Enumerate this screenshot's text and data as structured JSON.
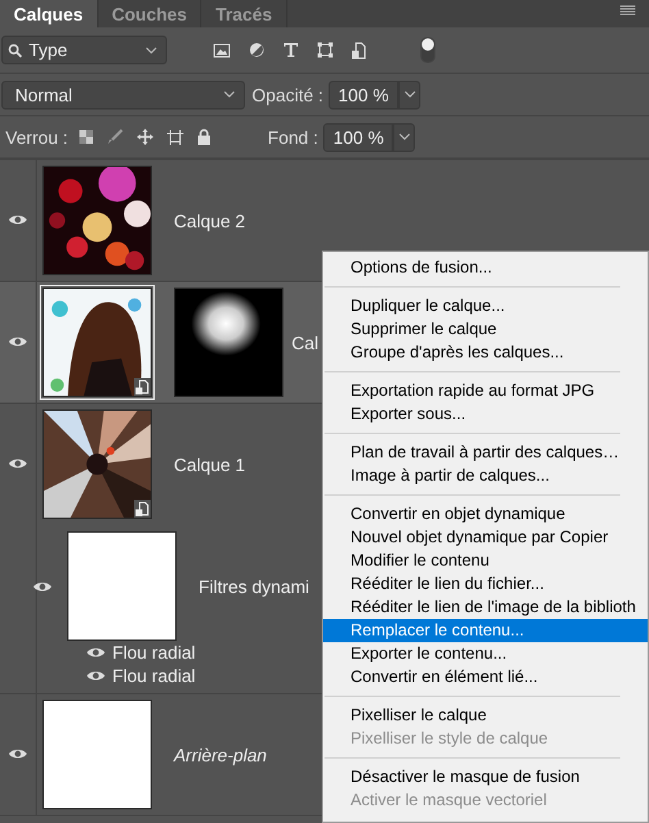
{
  "panel": {
    "tabs": [
      {
        "label": "Calques",
        "selected": true
      },
      {
        "label": "Couches",
        "selected": false
      },
      {
        "label": "Tracés",
        "selected": false
      }
    ],
    "filter": {
      "value": "Type"
    },
    "filter_switch": {
      "on": true
    },
    "blend_mode": {
      "value": "Normal"
    },
    "opacity": {
      "label": "Opacité :",
      "value": "100 %"
    },
    "lock": {
      "label": "Verrou :"
    },
    "fill": {
      "label": "Fond :",
      "value": "100 %"
    }
  },
  "layers": [
    {
      "name": "Calque 2",
      "visible": true,
      "selected": false,
      "kind": "picture",
      "smart_object": false,
      "mask": false
    },
    {
      "name": "Cal",
      "visible": true,
      "selected": true,
      "kind": "picture",
      "smart_object": true,
      "mask": true
    },
    {
      "name": "Calque 1",
      "visible": true,
      "selected": false,
      "kind": "picture",
      "smart_object": true,
      "mask": false,
      "smart_filters": {
        "label": "Filtres dynami",
        "visible": true,
        "items": [
          {
            "name": "Flou radial",
            "visible": true
          },
          {
            "name": "Flou radial",
            "visible": true
          }
        ]
      }
    },
    {
      "name": "Arrière-plan",
      "visible": true,
      "selected": false,
      "kind": "background",
      "smart_object": false,
      "mask": false
    }
  ],
  "context_menu": {
    "groups": [
      [
        {
          "label": "Options de fusion...",
          "selected": false,
          "disabled": false
        }
      ],
      [
        {
          "label": "Dupliquer le calque...",
          "selected": false,
          "disabled": false
        },
        {
          "label": "Supprimer le calque",
          "selected": false,
          "disabled": false
        },
        {
          "label": "Groupe d'après les calques...",
          "selected": false,
          "disabled": false
        }
      ],
      [
        {
          "label": "Exportation rapide au format JPG",
          "selected": false,
          "disabled": false
        },
        {
          "label": "Exporter sous...",
          "selected": false,
          "disabled": false
        }
      ],
      [
        {
          "label": "Plan de travail à partir des calques…",
          "selected": false,
          "disabled": false
        },
        {
          "label": "Image à partir de calques...",
          "selected": false,
          "disabled": false
        }
      ],
      [
        {
          "label": "Convertir en objet dynamique",
          "selected": false,
          "disabled": false
        },
        {
          "label": "Nouvel objet dynamique par Copier",
          "selected": false,
          "disabled": false
        },
        {
          "label": "Modifier le contenu",
          "selected": false,
          "disabled": false
        },
        {
          "label": "Rééditer le lien du fichier...",
          "selected": false,
          "disabled": false
        },
        {
          "label": "Rééditer le lien de l'image de la biblioth",
          "selected": false,
          "disabled": false
        },
        {
          "label": "Remplacer le contenu...",
          "selected": true,
          "disabled": false
        },
        {
          "label": "Exporter le contenu...",
          "selected": false,
          "disabled": false
        },
        {
          "label": "Convertir en élément lié...",
          "selected": false,
          "disabled": false
        }
      ],
      [
        {
          "label": "Pixelliser le calque",
          "selected": false,
          "disabled": false
        },
        {
          "label": "Pixelliser le style de calque",
          "selected": false,
          "disabled": true
        }
      ],
      [
        {
          "label": "Désactiver le masque de fusion",
          "selected": false,
          "disabled": false
        },
        {
          "label": "Activer le masque vectoriel",
          "selected": false,
          "disabled": true
        }
      ]
    ]
  }
}
